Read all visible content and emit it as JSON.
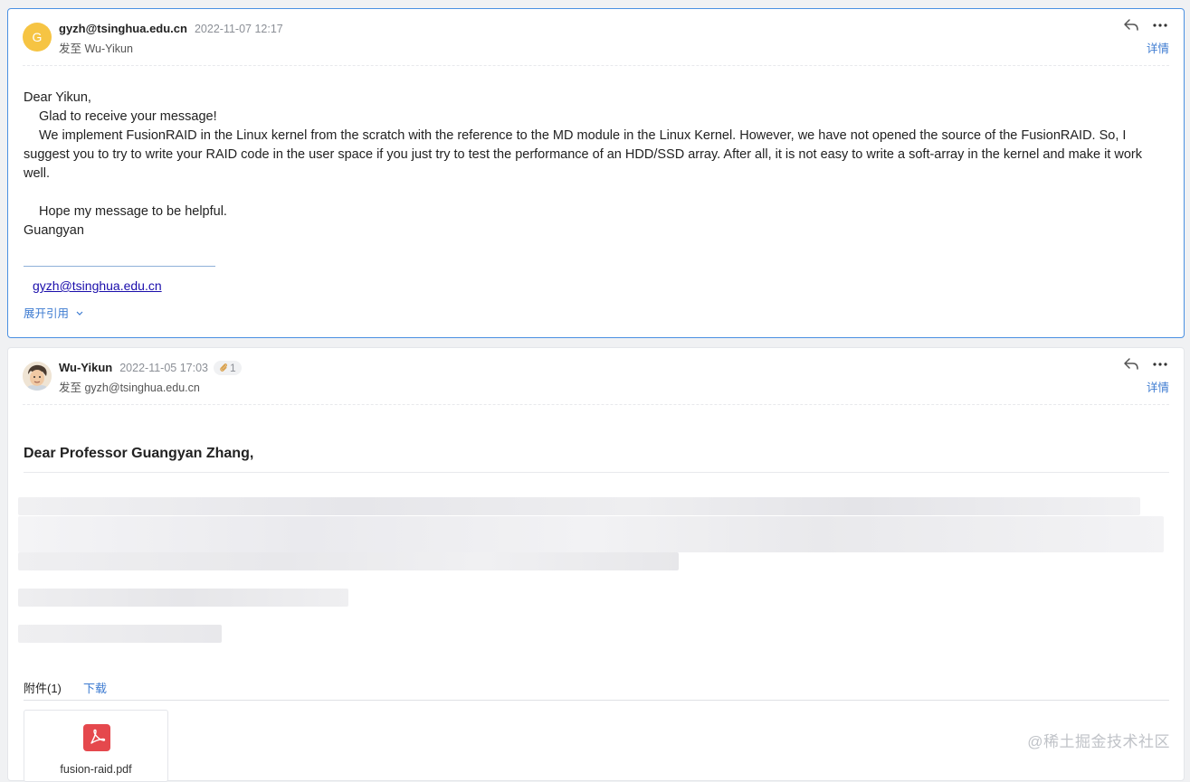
{
  "messages": [
    {
      "avatar_letter": "G",
      "sender": "gyzh@tsinghua.edu.cn",
      "time": "2022-11-07 12:17",
      "send_to": "发至 Wu-Yikun",
      "details_label": "详情",
      "body": [
        "Dear Yikun,",
        "Glad to receive your message!",
        "We implement FusionRAID in the Linux kernel from the scratch with the reference to the MD module in the Linux Kernel. However, we have not opened the source of the FusionRAID. So, I suggest you to try to write your RAID code in the user space if you just try to test the performance of an HDD/SSD array. After all, it is not easy to write a soft-array in the kernel and make it work well.",
        "Hope my message to be helpful.",
        "Guangyan"
      ],
      "signature_email": "gyzh@tsinghua.edu.cn",
      "expand_quote_label": "展开引用"
    },
    {
      "sender": "Wu-Yikun",
      "time": "2022-11-05 17:03",
      "attachment_count": "1",
      "send_to": "发至 gyzh@tsinghua.edu.cn",
      "details_label": "详情",
      "greeting": "Dear Professor Guangyan Zhang,",
      "attachments_header": "附件(1)",
      "download_label": "下载",
      "attachment_filename": "fusion-raid.pdf"
    }
  ],
  "watermark": "@稀土掘金技术社区",
  "colors": {
    "accent": "#3d7bd1",
    "active_border": "#4a90e2",
    "avatar_bg": "#f6c443",
    "pdf_red": "#e5484d"
  }
}
